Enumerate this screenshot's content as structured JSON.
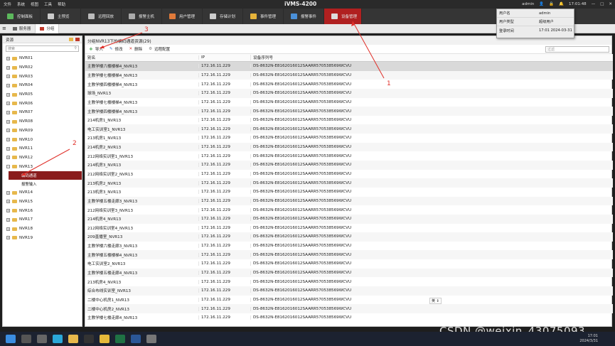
{
  "titlebar": {
    "menus": [
      "文件",
      "系统",
      "视图",
      "工具",
      "帮助"
    ],
    "app_title": "iVMS-4200",
    "user": "admin",
    "time": "17:01:48"
  },
  "nav": {
    "items": [
      {
        "label": "控制面板",
        "color": "#5cb85c"
      },
      {
        "label": "主预览",
        "color": "#dddddd"
      },
      {
        "label": "远程回放",
        "color": "#dddddd"
      },
      {
        "label": "报警主机",
        "color": "#dddddd"
      },
      {
        "label": "用户管理",
        "color": "#e07a3a"
      },
      {
        "label": "存储计划",
        "color": "#dddddd"
      },
      {
        "label": "事件管理",
        "color": "#e6b33a"
      },
      {
        "label": "报警事件",
        "color": "#4a90d9"
      },
      {
        "label": "设备管理",
        "color": "#dddddd"
      }
    ],
    "active_index": 8,
    "accent": "#b02020"
  },
  "tabs": [
    {
      "label": "服务器"
    },
    {
      "label": "分组"
    }
  ],
  "user_popup": {
    "rows": [
      {
        "key": "用户名",
        "value": "admin"
      },
      {
        "key": "用户类型",
        "value": "超级用户"
      },
      {
        "key": "登录时间",
        "value": "17:01 2024-03-31"
      }
    ]
  },
  "left": {
    "header": "资源",
    "search_placeholder": "搜索",
    "tree_before": [
      "NVR01",
      "NVR02",
      "NVR03",
      "NVR04",
      "NVR05",
      "NVR06",
      "NVR07",
      "NVR08",
      "NVR09",
      "NVR10",
      "NVR11",
      "NVR12"
    ],
    "expanded": "NVR13",
    "children": [
      "编码通道",
      "报警输入"
    ],
    "selected_child": 0,
    "tree_after": [
      "NVR14",
      "NVR15",
      "NVR16",
      "NVR17",
      "NVR18",
      "NVR19"
    ]
  },
  "main": {
    "title": "分组NVR13下的编码通道资源(29)",
    "toolbar": {
      "import": "导入",
      "modify": "修改",
      "delete": "删除",
      "remote": "远程配置",
      "filter_placeholder": "过滤"
    },
    "columns": [
      "别名",
      "IP",
      "设备序列号"
    ],
    "rows": [
      [
        "主教学楼六楼楼梯4_NVR13",
        "172.16.11.229",
        "DS-8632N-E8162016012SAARR570538569WCVU"
      ],
      [
        "主教学楼七楼楼梯4_NVR13",
        "172.16.11.229",
        "DS-8632N-E8162016012SAARR570538569WCVU"
      ],
      [
        "主教学楼四楼楼梯4_NVR13",
        "172.16.11.229",
        "DS-8632N-E8162016012SAARR570538569WCVU"
      ],
      [
        "球场_NVR13",
        "172.16.11.229",
        "DS-8632N-E8162016012SAARR570538569WCVU"
      ],
      [
        "主教学楼七楼楼梯4_NVR13",
        "172.16.11.229",
        "DS-8632N-E8162016012SAARR570538569WCVU"
      ],
      [
        "主教学楼四楼楼梯4_NVR13",
        "172.16.11.229",
        "DS-8632N-E8162016012SAARR570538569WCVU"
      ],
      [
        "214机房1_NVR13",
        "172.16.11.229",
        "DS-8632N-E8162016012SAARR570538569WCVU"
      ],
      [
        "电工实训室1_NVR13",
        "172.16.11.229",
        "DS-8632N-E8162016012SAARR570538569WCVU"
      ],
      [
        "213机房1_NVR13",
        "172.16.11.229",
        "DS-8632N-E8162016012SAARR570538569WCVU"
      ],
      [
        "214机房2_NVR13",
        "172.16.11.229",
        "DS-8632N-E8162016012SAARR570538569WCVU"
      ],
      [
        "212网络实训室1_NVR13",
        "172.16.11.229",
        "DS-8632N-E8162016012SAARR570538569WCVU"
      ],
      [
        "214机房3_NVR13",
        "172.16.11.229",
        "DS-8632N-E8162016012SAARR570538569WCVU"
      ],
      [
        "212网络实训室2_NVR13",
        "172.16.11.229",
        "DS-8632N-E8162016012SAARR570538569WCVU"
      ],
      [
        "213机房2_NVR13",
        "172.16.11.229",
        "DS-8632N-E8162016012SAARR570538569WCVU"
      ],
      [
        "213机房3_NVR13",
        "172.16.11.229",
        "DS-8632N-E8162016012SAARR570538569WCVU"
      ],
      [
        "主教学楼五楼走廊3_NVR13",
        "172.16.11.229",
        "DS-8632N-E8162016012SAARR570538569WCVU"
      ],
      [
        "212网络实训室3_NVR13",
        "172.16.11.229",
        "DS-8632N-E8162016012SAARR570538569WCVU"
      ],
      [
        "214机房4_NVR13",
        "172.16.11.229",
        "DS-8632N-E8162016012SAARR570538569WCVU"
      ],
      [
        "212网络实训室4_NVR13",
        "172.16.11.229",
        "DS-8632N-E8162016012SAARR570538569WCVU"
      ],
      [
        "209直播室_NVR13",
        "172.16.11.229",
        "DS-8632N-E8162016012SAARR570538569WCVU"
      ],
      [
        "主教学楼六楼走廊3_NVR13",
        "172.16.11.229",
        "DS-8632N-E8162016012SAARR570538569WCVU"
      ],
      [
        "主教学楼五楼楼梯4_NVR13",
        "172.16.11.229",
        "DS-8632N-E8162016012SAARR570538569WCVU"
      ],
      [
        "电工实训室2_NVR13",
        "172.16.11.229",
        "DS-8632N-E8162016012SAARR570538569WCVU"
      ],
      [
        "主教学楼五楼走廊4_NVR13",
        "172.16.11.229",
        "DS-8632N-E8162016012SAARR570538569WCVU"
      ],
      [
        "213机房4_NVR13",
        "172.16.11.229",
        "DS-8632N-E8162016012SAARR570538569WCVU"
      ],
      [
        "综合布线实训室_NVR13",
        "172.16.11.229",
        "DS-8632N-E8162016012SAARR570538569WCVU"
      ],
      [
        "二楼中心机房1_NVR13",
        "172.16.11.229",
        "DS-8632N-E8162016012SAARR570538569WCVU"
      ],
      [
        "二楼中心机房2_NVR13",
        "172.16.11.229",
        "DS-8632N-E8162016012SAARR570538569WCVU"
      ],
      [
        "主教学楼七楼走廊4_NVR13",
        "172.16.11.229",
        "DS-8632N-E8162016012SAARR570538569WCVU"
      ]
    ],
    "selected_row": 0,
    "ime": "英"
  },
  "annotations": [
    "1",
    "2",
    "3"
  ],
  "watermark": "CSDN @weixin_43075093",
  "taskbar": {
    "time": "17:01",
    "date": "2024/3/31"
  }
}
